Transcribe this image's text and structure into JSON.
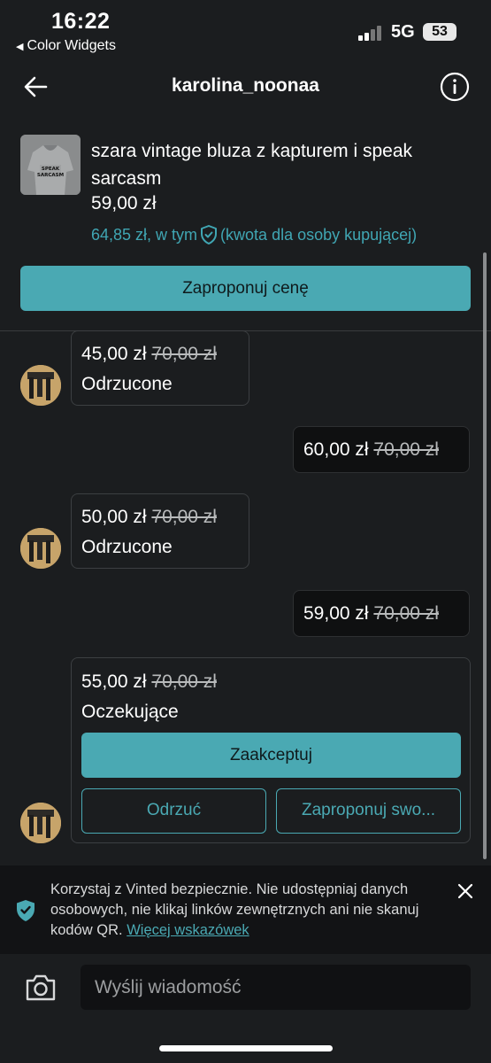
{
  "status_bar": {
    "time": "16:22",
    "back_app": "Color Widgets",
    "network": "5G",
    "battery": "53"
  },
  "header": {
    "title": "karolina_noonaa"
  },
  "item": {
    "title": "szara vintage bluza z kapturem i speak sarcasm",
    "price": "59,00 zł",
    "buyer_price": "64,85 zł, w tym",
    "buyer_note": "(kwota dla osoby kupującej)",
    "thumb_text": "SPEAK SARCASM"
  },
  "propose_button": "Zaproponuj cenę",
  "messages": [
    {
      "direction": "incoming",
      "price": "45,00 zł",
      "old_price": "70,00 zł",
      "status": "Odrzucone"
    },
    {
      "direction": "outgoing",
      "price": "60,00 zł",
      "old_price": "70,00 zł"
    },
    {
      "direction": "incoming",
      "price": "50,00 zł",
      "old_price": "70,00 zł",
      "status": "Odrzucone"
    },
    {
      "direction": "outgoing",
      "price": "59,00 zł",
      "old_price": "70,00 zł"
    },
    {
      "direction": "incoming",
      "price": "55,00 zł",
      "old_price": "70,00 zł",
      "status": "Oczekujące"
    }
  ],
  "pending_actions": {
    "accept": "Zaakceptuj",
    "decline": "Odrzuć",
    "counter": "Zaproponuj swo..."
  },
  "safety_banner": {
    "text": "Korzystaj z Vinted bezpiecznie. Nie udostępniaj danych osobowych, nie klikaj linków zewnętrznych ani nie skanuj kodów QR.",
    "link": "Więcej wskazówek"
  },
  "composer": {
    "placeholder": "Wyślij wiadomość"
  },
  "colors": {
    "accent": "#4aa9b3",
    "background": "#1b1d1f"
  }
}
